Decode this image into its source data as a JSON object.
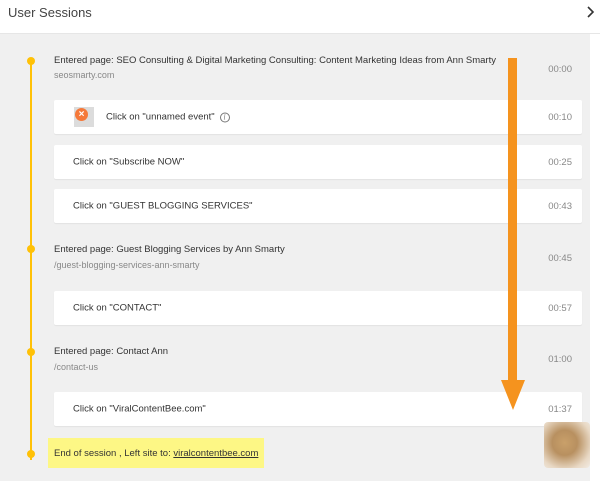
{
  "header": {
    "title": "User Sessions"
  },
  "session": {
    "entries": [
      {
        "kind": "page",
        "title": "Entered page: SEO Consulting & Digital Marketing Consulting: Content Marketing Ideas from Ann Smarty",
        "url": "seosmarty.com",
        "time": "00:00"
      },
      {
        "kind": "click",
        "label": "Click on \"unnamed event\"",
        "time": "00:10"
      },
      {
        "kind": "click",
        "label": "Click on \"Subscribe NOW\"",
        "time": "00:25"
      },
      {
        "kind": "click",
        "label": "Click on \"GUEST BLOGGING SERVICES\"",
        "time": "00:43"
      },
      {
        "kind": "page",
        "title": "Entered page: Guest Blogging Services by Ann Smarty",
        "url": "/guest-blogging-services-ann-smarty",
        "time": "00:45"
      },
      {
        "kind": "click",
        "label": "Click on \"CONTACT\"",
        "time": "00:57"
      },
      {
        "kind": "page",
        "title": "Entered page: Contact Ann",
        "url": "/contact-us",
        "time": "01:00"
      },
      {
        "kind": "click",
        "label": "Click on \"ViralContentBee.com\"",
        "time": "01:37"
      }
    ],
    "end": {
      "text": "End of session , Left site to:",
      "link": "viralcontentbee.com"
    }
  },
  "colors": {
    "timeline": "#ffc107",
    "arrow": "#f5931e",
    "highlight": "#fdf785",
    "event_icon": "#f5793a"
  },
  "icons": {
    "header_chevron": "chevron-right-icon",
    "event": "close-circle-icon",
    "info": "info-icon"
  }
}
